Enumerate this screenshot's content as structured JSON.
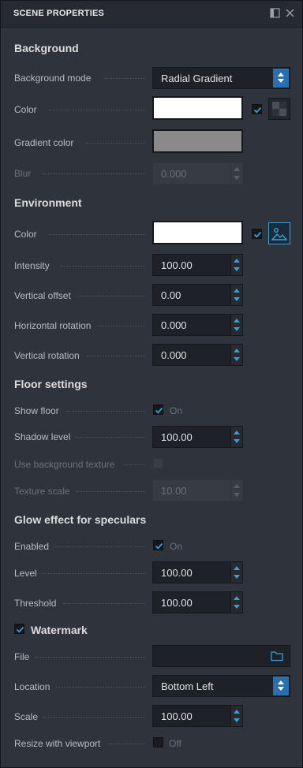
{
  "panel": {
    "title": "SCENE PROPERTIES"
  },
  "background": {
    "heading": "Background",
    "mode_label": "Background mode",
    "mode_value": "Radial Gradient",
    "color_label": "Color",
    "color_value": "#ffffff",
    "color_checked": true,
    "gradient_label": "Gradient color",
    "gradient_value": "#8a8a8a",
    "blur_label": "Blur",
    "blur_value": "0.000"
  },
  "environment": {
    "heading": "Environment",
    "color_label": "Color",
    "color_value": "#ffffff",
    "color_checked": true,
    "intensity_label": "Intensity",
    "intensity_value": "100.00",
    "voffset_label": "Vertical offset",
    "voffset_value": "0.00",
    "hrot_label": "Horizontal rotation",
    "hrot_value": "0.000",
    "vrot_label": "Vertical rotation",
    "vrot_value": "0.000"
  },
  "floor": {
    "heading": "Floor settings",
    "show_label": "Show floor",
    "show_state": "On",
    "show_checked": true,
    "shadow_label": "Shadow level",
    "shadow_value": "100.00",
    "usebg_label": "Use background texture",
    "texscale_label": "Texture scale",
    "texscale_value": "10.00"
  },
  "glow": {
    "heading": "Glow effect for speculars",
    "enabled_label": "Enabled",
    "enabled_state": "On",
    "enabled_checked": true,
    "level_label": "Level",
    "level_value": "100.00",
    "threshold_label": "Threshold",
    "threshold_value": "100.00"
  },
  "watermark": {
    "heading": "Watermark",
    "checked": true,
    "file_label": "File",
    "file_value": "",
    "location_label": "Location",
    "location_value": "Bottom Left",
    "scale_label": "Scale",
    "scale_value": "100.00",
    "resize_label": "Resize with viewport",
    "resize_state": "Off",
    "resize_checked": false
  },
  "colors": {
    "accent": "#3a9fd8",
    "panel_bg": "#2f333c",
    "field_bg": "#1e2127",
    "select_spin": "#2b6fae"
  },
  "icons": [
    "dock-panel-icon",
    "close-icon",
    "checkerboard-icon",
    "image-landscape-icon",
    "folder-icon",
    "checkmark-icon"
  ]
}
